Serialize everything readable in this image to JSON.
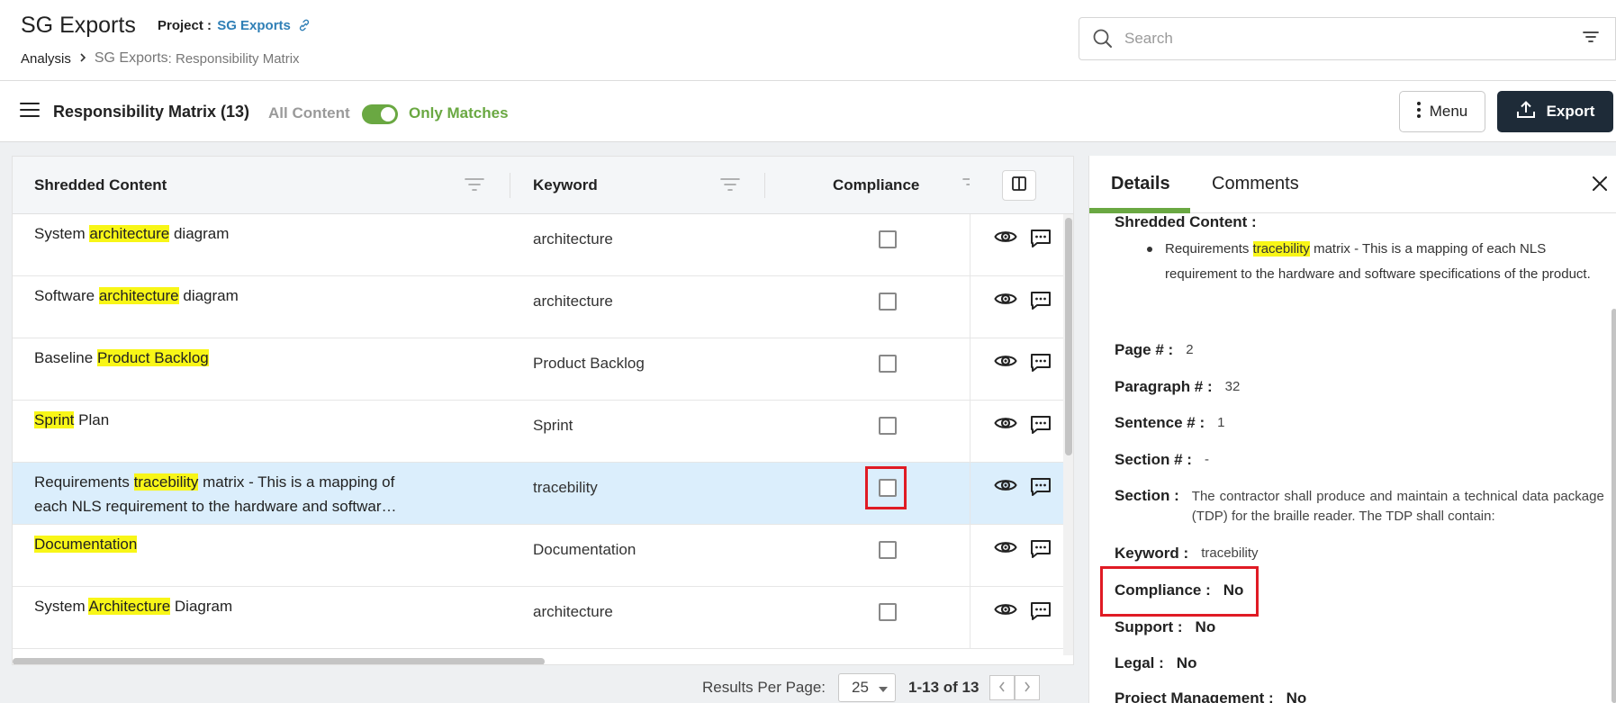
{
  "header": {
    "app_title": "SG Exports",
    "project_label": "Project :",
    "project_name": "SG Exports",
    "breadcrumb": {
      "root": "Analysis",
      "current": "SG Exports",
      "sub": " : Responsibility Matrix"
    },
    "search_placeholder": "Search"
  },
  "toolbar": {
    "title": "Responsibility Matrix (13)",
    "toggle_left": "All Content",
    "toggle_right": "Only Matches",
    "toggle_on": true,
    "menu_label": "Menu",
    "export_label": "Export"
  },
  "table": {
    "columns": {
      "content": "Shredded Content",
      "keyword": "Keyword",
      "compliance": "Compliance"
    },
    "rows": [
      {
        "pre": "System ",
        "hl": "architecture",
        "post": " diagram",
        "line2": "",
        "keyword": "architecture",
        "selected": false
      },
      {
        "pre": "Software ",
        "hl": "architecture",
        "post": " diagram",
        "line2": "",
        "keyword": "architecture",
        "selected": false
      },
      {
        "pre": "Baseline ",
        "hl": "Product Backlog",
        "post": "",
        "line2": "",
        "keyword": "Product Backlog",
        "selected": false
      },
      {
        "pre": "",
        "hl": "Sprint",
        "post": " Plan",
        "line2": "",
        "keyword": "Sprint",
        "selected": false
      },
      {
        "pre": "Requirements ",
        "hl": "tracebility",
        "post": " matrix - This is a mapping of",
        "line2": "each NLS requirement to the hardware and softwar…",
        "keyword": "tracebility",
        "selected": true
      },
      {
        "pre": "",
        "hl": "Documentation",
        "post": "",
        "line2": "",
        "keyword": "Documentation",
        "selected": false
      },
      {
        "pre": "System ",
        "hl": "Architecture",
        "post": " Diagram",
        "line2": "",
        "keyword": "architecture",
        "selected": false
      }
    ]
  },
  "pagination": {
    "label": "Results Per Page:",
    "per_page": "25",
    "range": "1-13 of 13"
  },
  "details": {
    "tabs": [
      "Details",
      "Comments"
    ],
    "shredded_label": "Shredded Content :",
    "shredded_pre": "Requirements ",
    "shredded_hl": "tracebility",
    "shredded_post": " matrix - This is a mapping of each NLS requirement to the hardware and software specifications of the product.",
    "fields": {
      "page_label": "Page # :",
      "page": "2",
      "paragraph_label": "Paragraph # :",
      "paragraph": "32",
      "sentence_label": "Sentence # :",
      "sentence": "1",
      "section_no_label": "Section # :",
      "section_no": "-",
      "section_label": "Section :",
      "section": "The contractor shall produce and maintain a technical data package (TDP) for the braille reader. The TDP shall contain:",
      "keyword_label": "Keyword :",
      "keyword": "tracebility",
      "compliance_label": "Compliance :",
      "compliance": "No",
      "support_label": "Support :",
      "support": "No",
      "legal_label": "Legal :",
      "legal": "No",
      "pm_label": "Project Management :",
      "pm": "No"
    }
  },
  "colors": {
    "accent_green": "#6aa842",
    "highlight": "#f8f617",
    "link_blue": "#2f7fb6",
    "export_bg": "#1e2b38",
    "callout_red": "#e01b24",
    "selected_row": "#dbeefc"
  }
}
